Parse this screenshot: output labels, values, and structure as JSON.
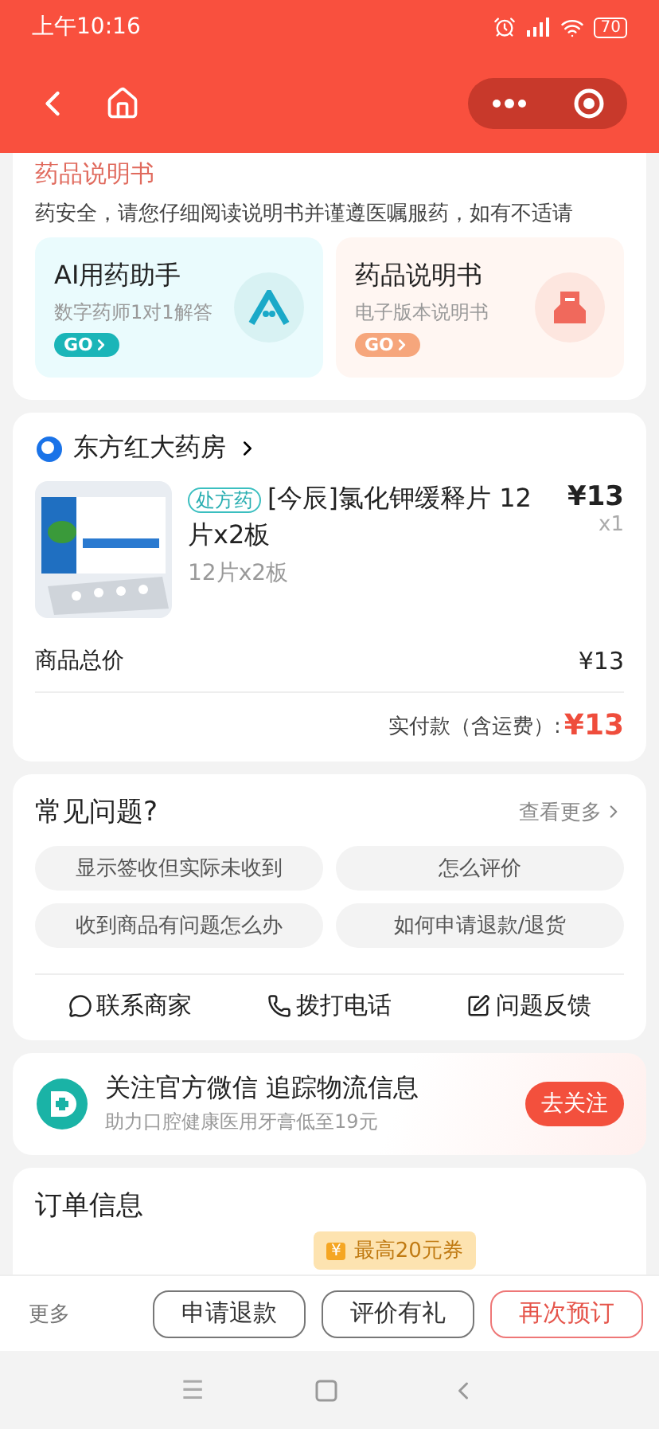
{
  "status_bar": {
    "time": "上午10:16",
    "battery": "70"
  },
  "instructions_card": {
    "title": "药品说明书",
    "notice": "药安全，请您仔细阅读说明书并谨遵医嘱服药，如有不适请",
    "tiles": [
      {
        "kind": "ai",
        "title": "AI用药助手",
        "subtitle": "数字药师1对1解答",
        "go": "GO"
      },
      {
        "kind": "manual",
        "title": "药品说明书",
        "subtitle": "电子版本说明书",
        "go": "GO"
      }
    ]
  },
  "store": {
    "name": "东方红大药房",
    "product": {
      "tag": "处方药",
      "name": "[今辰]氯化钾缓释片 12片x2板",
      "spec": "12片x2板",
      "price": "13",
      "currency": "¥",
      "quantity": "x1"
    },
    "total_label": "商品总价",
    "total": "¥13",
    "paid_label": "实付款（含运费）:",
    "paid_currency": "¥",
    "paid": "13"
  },
  "faq": {
    "title": "常见问题?",
    "more": "查看更多",
    "questions": [
      "显示签收但实际未收到",
      "怎么评价",
      "收到商品有问题怎么办",
      "如何申请退款/退货"
    ],
    "actions": [
      {
        "kind": "chat",
        "label": "联系商家"
      },
      {
        "kind": "phone",
        "label": "拨打电话"
      },
      {
        "kind": "feedback",
        "label": "问题反馈"
      }
    ]
  },
  "follow_banner": {
    "title": "关注官方微信 追踪物流信息",
    "subtitle": "助力口腔健康医用牙膏低至19元",
    "button": "去关注"
  },
  "order_info": {
    "title": "订单信息"
  },
  "bottom_bar": {
    "more": "更多",
    "coupon": "最高20元券",
    "coupon_icon": "¥",
    "buttons": [
      {
        "label": "申请退款",
        "primary": false
      },
      {
        "label": "评价有礼",
        "primary": false
      },
      {
        "label": "再次预订",
        "primary": true
      }
    ]
  },
  "system_nav": {
    "menu": "☰"
  }
}
